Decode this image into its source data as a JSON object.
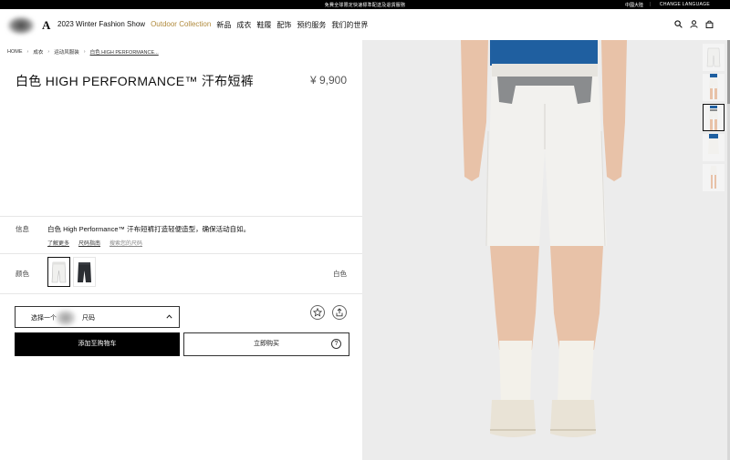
{
  "topbar": {
    "promo": "免費全球限定快速標準配送及退貨服務",
    "region": "中國大陸",
    "separator": "|",
    "language": "CHANGE LANGUAGE"
  },
  "header": {
    "logo_letter": "A",
    "nav": [
      {
        "label": "2023 Winter Fashion Show",
        "accent": false
      },
      {
        "label": "Outdoor Collection",
        "accent": true
      },
      {
        "label": "新品",
        "accent": false
      },
      {
        "label": "成衣",
        "accent": false
      },
      {
        "label": "鞋履",
        "accent": false
      },
      {
        "label": "配饰",
        "accent": false
      },
      {
        "label": "预约服务",
        "accent": false
      },
      {
        "label": "我们的世界",
        "accent": false
      }
    ],
    "icons": [
      "search-icon",
      "user-icon",
      "bag-icon"
    ]
  },
  "breadcrumb": [
    "HOME",
    "成衣",
    "运动风服装",
    "白色 HIGH PERFORMANCE..."
  ],
  "product": {
    "title": "白色 HIGH PERFORMANCE™ 汗布短裤",
    "price": "¥ 9,900",
    "info_label": "信息",
    "info_text": "白色 High Performance™ 汗布短裤打造轻便造型，确保活动自如。",
    "info_links": [
      "了解更多",
      "尺码指南",
      "搜索您的尺码"
    ],
    "color_label": "颜色",
    "color_value": "白色",
    "swatches": [
      {
        "name": "白色",
        "fill": "#f0f0ee",
        "selected": true
      },
      {
        "name": "黑色",
        "fill": "#2b2e33",
        "selected": false
      }
    ],
    "size_placeholder": "选择一个",
    "size_suffix": "尺码",
    "add_to_cart": "添加至购物车",
    "buy_now": "立即购买",
    "help_glyph": "?"
  },
  "colors": {
    "accent": "#b08a3c",
    "shorts": "#f2f1ee",
    "shirt": "#1f5fa0",
    "waistband_panel": "#8a8c8e",
    "skin": "#e8c2a8",
    "socks": "#f3f1ea",
    "shoes": "#e9e3d6",
    "background": "#ececec"
  }
}
